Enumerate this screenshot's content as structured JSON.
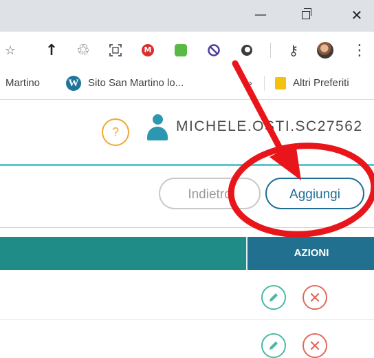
{
  "window": {
    "minimize_glyph": "—",
    "close_glyph": "✕"
  },
  "toolbar": {
    "icons": [
      "star-icon",
      "upload-arrow-icon",
      "recycle-icon",
      "screenshot-icon",
      "mail-extension-icon",
      "green-extension-icon",
      "block-icon",
      "circle-extension-icon",
      "key-icon",
      "profile-avatar",
      "more-menu-icon"
    ],
    "upload_glyph": "↑",
    "recycle_glyph": "♲",
    "key_glyph": "⚷",
    "more_glyph": "⋮",
    "star_glyph": "☆"
  },
  "bookmarks": {
    "item1": "Martino",
    "item2": "Sito San Martino lo...",
    "chevron": "»",
    "other": "Altri Preferiti"
  },
  "header": {
    "help": "?",
    "username": "MICHELE.OSTI.SC27562"
  },
  "actions": {
    "back": "Indietro",
    "add": "Aggiungi"
  },
  "table": {
    "actions_header": "AZIONI",
    "rows": [
      {
        "edit": "edit-icon",
        "delete": "delete-icon"
      },
      {
        "edit": "edit-icon",
        "delete": "delete-icon"
      }
    ]
  },
  "colors": {
    "teal_header": "#1f8c87",
    "actions_header": "#21708f",
    "add_button": "#1e6f93",
    "edit": "#49b8a4",
    "delete": "#e06a5a",
    "annotation": "#e8161b",
    "help": "#f0a830"
  }
}
